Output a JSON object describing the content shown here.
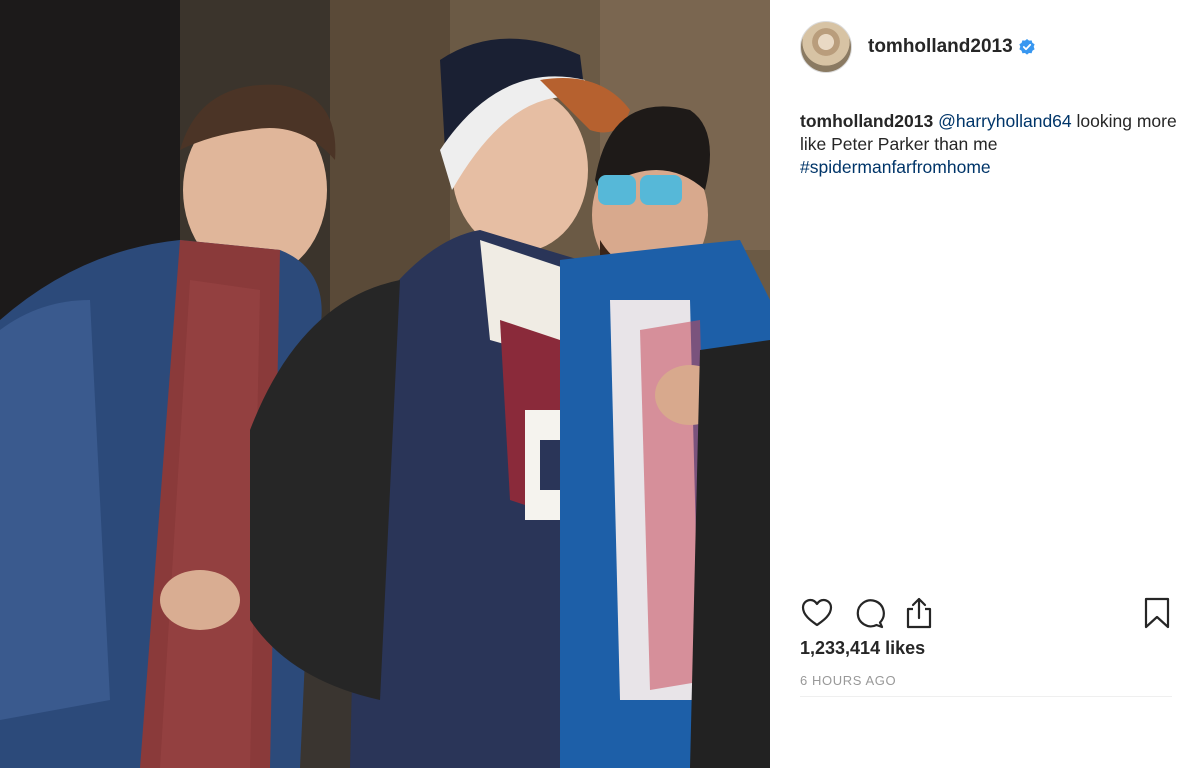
{
  "post": {
    "username": "tomholland2013",
    "verified": true,
    "caption": {
      "user": "tomholland2013",
      "mention": "@harryholland64",
      "text": " looking more like Peter Parker than me",
      "hashtag": "#spidermanfarfromhome"
    },
    "likes": "1,233,414 likes",
    "time": "6 HOURS AGO"
  },
  "photo": {
    "description_icons": [
      "photo"
    ]
  },
  "colors": {
    "text": "#262626",
    "link": "#003569",
    "muted": "#999999",
    "verified_blue": "#3897f0",
    "divider": "#efefef"
  },
  "icons": {
    "like": "heart-icon",
    "comment": "comment-icon",
    "share": "share-icon",
    "save": "bookmark-icon"
  }
}
